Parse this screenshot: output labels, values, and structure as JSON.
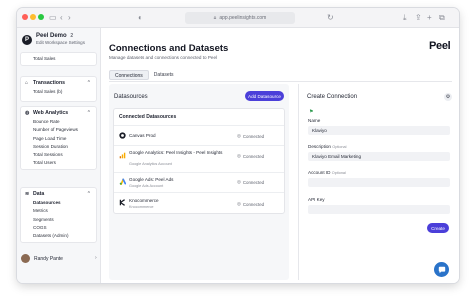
{
  "browser": {
    "url": "app.peelinsights.com",
    "sidebar_toggle_icon": "sidebar-icon",
    "back_icon": "chevron-left-icon",
    "forward_icon": "chevron-right-icon"
  },
  "workspace": {
    "name": "Peel Demo",
    "badge": "2",
    "subtitle": "Edit Workspace Settings"
  },
  "sidebar": {
    "top_item": "Total Sales",
    "sections": [
      {
        "title": "Transactions",
        "items": [
          "Total Sales (b)"
        ]
      },
      {
        "title": "Web Analytics",
        "items": [
          "Bounce Rate",
          "Number of Pageviews",
          "Page Load Time",
          "Session Duration",
          "Total Sessions",
          "Total Users"
        ]
      },
      {
        "title": "Data",
        "items": [
          "Datasources",
          "Metrics",
          "Segments",
          "COGS",
          "Datasets (Admin)"
        ]
      }
    ],
    "user": {
      "name": "Randy Pante"
    }
  },
  "page": {
    "title": "Connections and Datasets",
    "subtitle": "Manage datasets and connections connected to Peel",
    "brand": "Peel",
    "tabs": [
      {
        "label": "Connections",
        "active": true
      },
      {
        "label": "Datasets",
        "active": false
      }
    ]
  },
  "datasources": {
    "title": "Datasources",
    "add_button": "Add Datasource",
    "list_title": "Connected Datasources",
    "items": [
      {
        "name": "Canvas Prod",
        "sub": "",
        "status": "Connected",
        "logo_color": "#1a1d27"
      },
      {
        "name": "Google Analytics: Peel Insights - Peel Insights",
        "sub": "Google Analytics Account",
        "status": "Connected",
        "logo_color": "#f29900"
      },
      {
        "name": "Google Ads: Peel Ads",
        "sub": "Google Ads Account",
        "status": "Connected",
        "logo_color": "#4285f4"
      },
      {
        "name": "Knocommerce",
        "sub": "Knocommerce",
        "status": "Connected",
        "logo_color": "#1a1d27"
      }
    ]
  },
  "create_connection": {
    "title": "Create Connection",
    "name_label": "Name",
    "name_value": "Klaviyo",
    "description_label": "Description",
    "description_optional": "Optional",
    "description_value": "Klaviyo Email Marketing",
    "account_id_label": "Account ID",
    "account_id_optional": "Optional",
    "account_id_value": "",
    "api_key_label": "API Key",
    "api_key_value": "",
    "create_button": "Create"
  }
}
